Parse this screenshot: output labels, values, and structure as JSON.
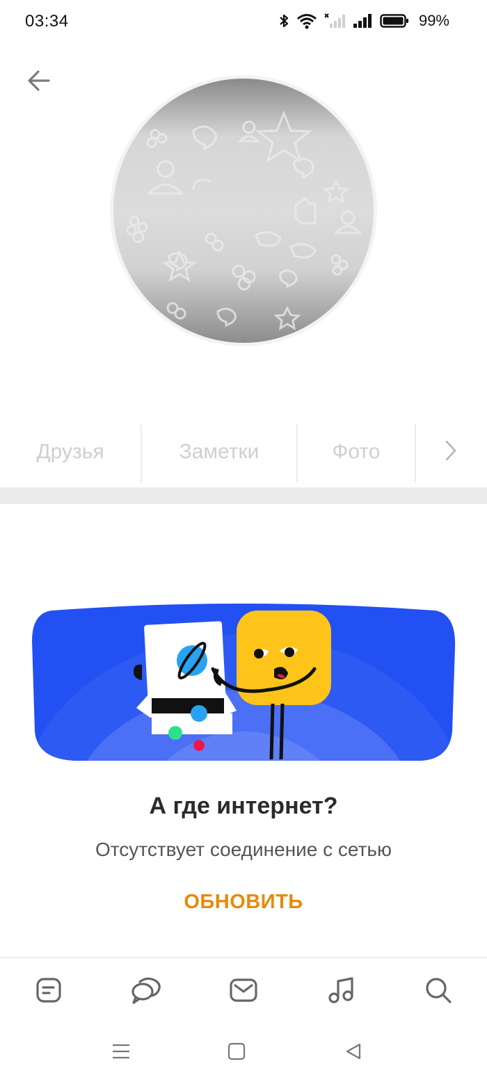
{
  "status_bar": {
    "time": "03:34",
    "battery_percent": "99%",
    "icons": [
      "bluetooth-icon",
      "wifi-icon",
      "signal-1-icon",
      "signal-2-icon",
      "battery-icon"
    ]
  },
  "header": {
    "back_icon": "arrow-left-icon"
  },
  "profile": {
    "avatar": "placeholder-avatar"
  },
  "tabs": {
    "items": [
      {
        "label": "Друзья"
      },
      {
        "label": "Заметки"
      },
      {
        "label": "Фото"
      }
    ],
    "next_icon": "chevron-right-icon"
  },
  "error": {
    "title": "А где интернет?",
    "subtitle": "Отсутствует соединение с сетью",
    "refresh_label": "ОБНОВИТЬ",
    "accent_color": "#e68a0c"
  },
  "bottom_nav": {
    "items": [
      {
        "icon": "feed-icon"
      },
      {
        "icon": "discussions-icon"
      },
      {
        "icon": "messages-icon"
      },
      {
        "icon": "music-icon"
      },
      {
        "icon": "search-icon"
      }
    ]
  },
  "system_nav": {
    "items": [
      "menu-icon",
      "home-icon",
      "back-triangle-icon"
    ]
  }
}
